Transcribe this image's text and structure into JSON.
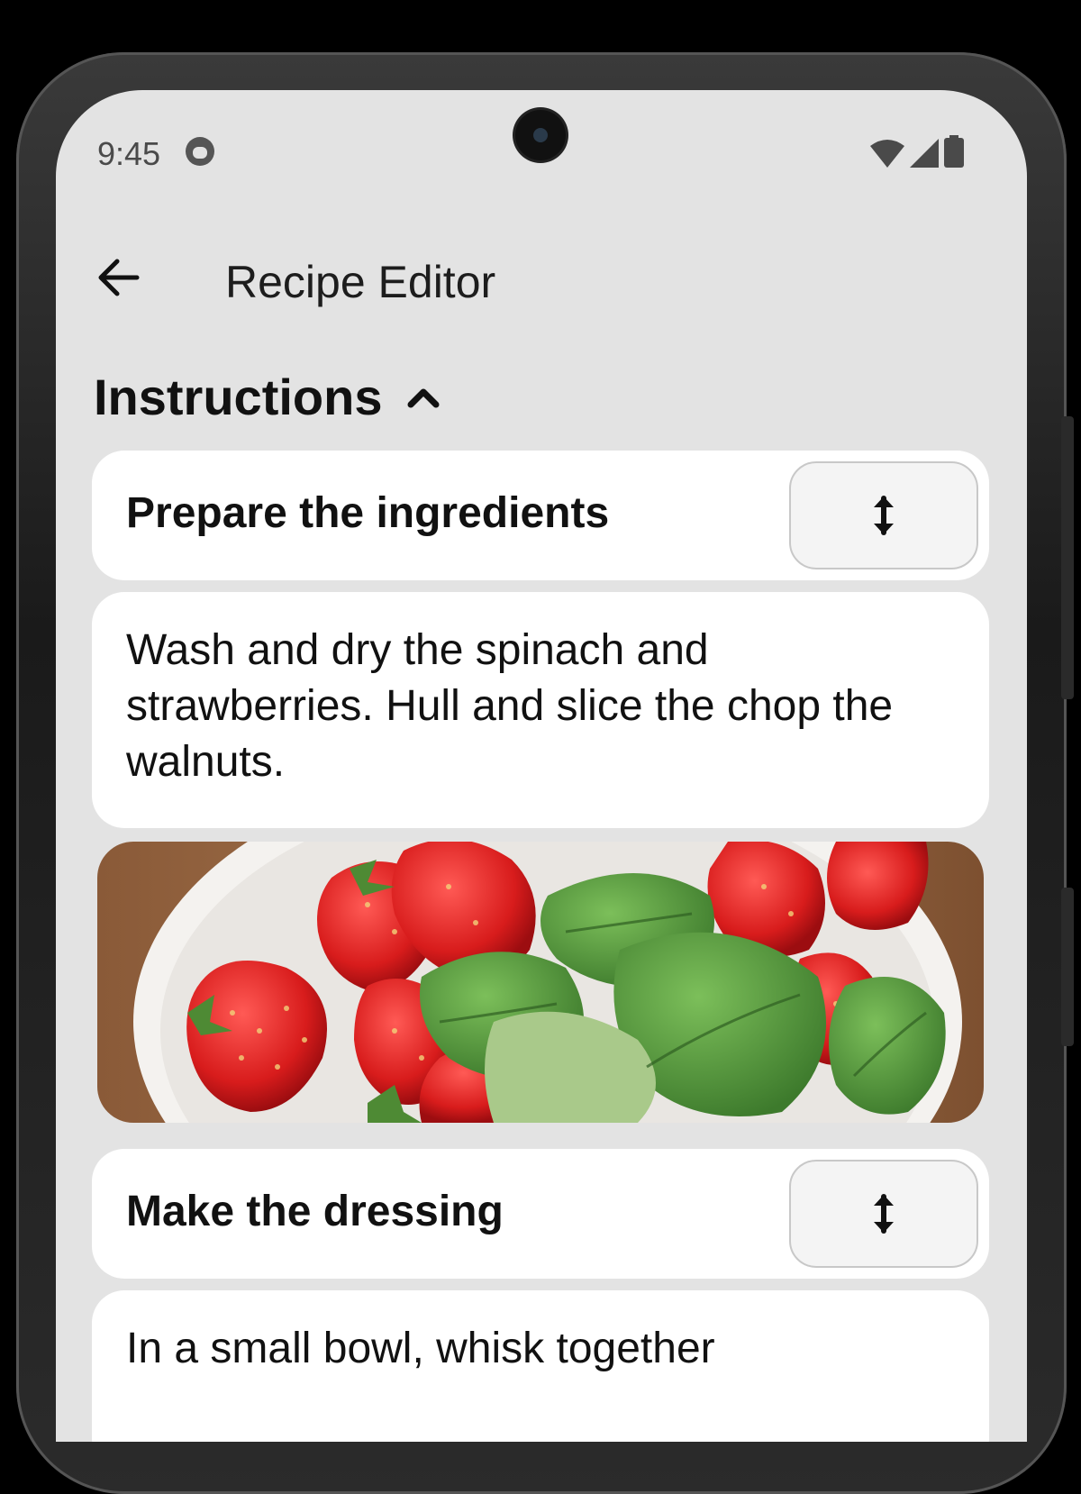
{
  "status_bar": {
    "time": "9:45",
    "icons": [
      "notification-cat-icon",
      "wifi-icon",
      "cellular-signal-icon",
      "battery-icon"
    ]
  },
  "app_bar": {
    "title": "Recipe Editor",
    "back_icon": "arrow-left-icon"
  },
  "section": {
    "label": "Instructions",
    "toggle_icon": "chevron-up-icon"
  },
  "steps": [
    {
      "title": "Prepare the ingredients",
      "description": "Wash and dry the spinach and strawberries. Hull and slice the  chop the walnuts.",
      "drag_icon": "vertical-drag-arrows-icon"
    },
    {
      "title": "Make the dressing",
      "description": "In a small bowl, whisk together",
      "drag_icon": "vertical-drag-arrows-icon"
    }
  ],
  "photo": {
    "subject": "strawberries-and-spinach-bowl"
  },
  "colors": {
    "screen_background": "#e3e3e3",
    "card_background": "#ffffff",
    "text": "#111111"
  }
}
